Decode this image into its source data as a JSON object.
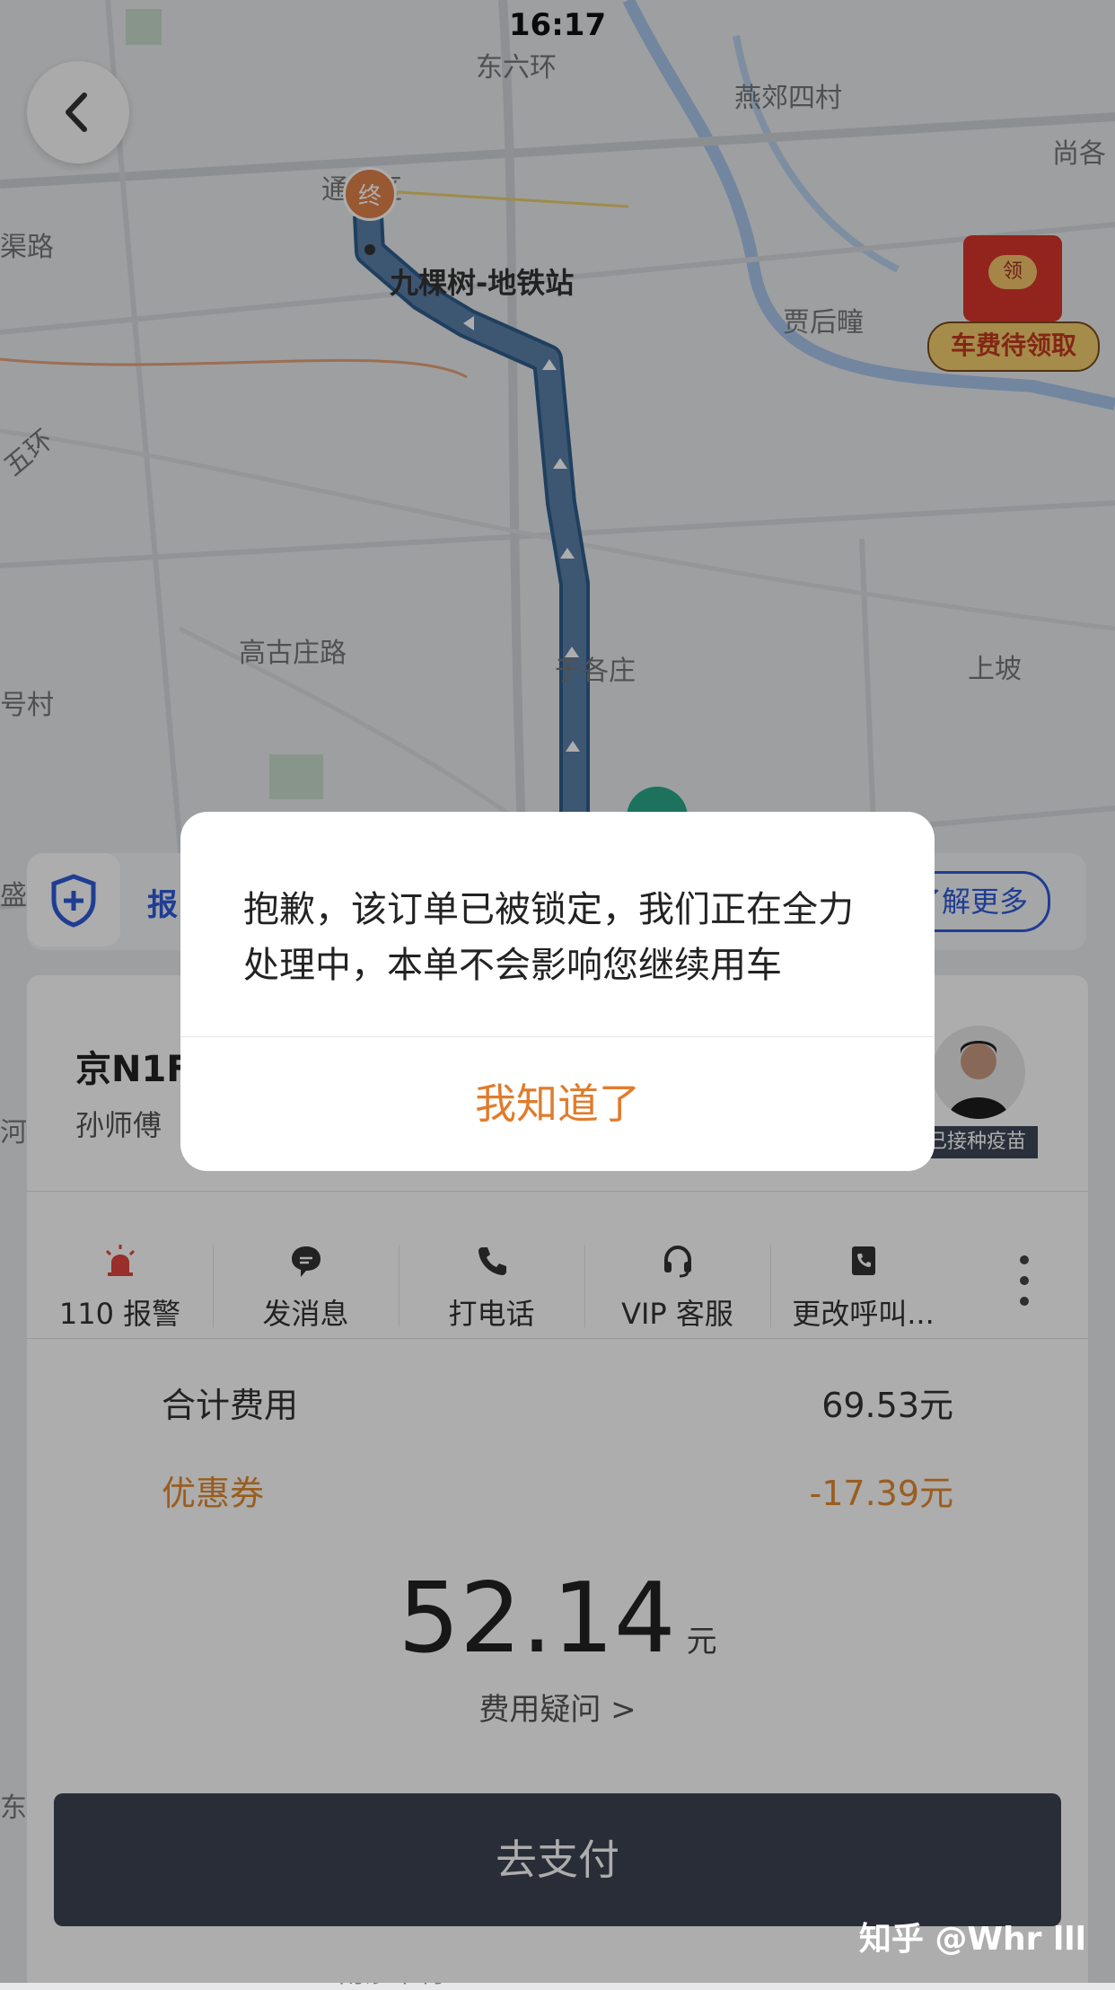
{
  "status_bar": {
    "time": "16:17"
  },
  "map": {
    "labels": {
      "ring_road": "东六环",
      "area1": "燕郊四村",
      "area2": "尚各",
      "area3": "渠路",
      "area4": "通州区",
      "station": "九棵树-地铁站",
      "area5": "贾后疃",
      "ring5": "五环",
      "area6": "高古庄路",
      "area7": "于各庄",
      "area8": "上坡",
      "area9": "号村",
      "area10": "盛",
      "area11": "南莎平村",
      "area12": "河",
      "area13": "东"
    },
    "end_pin": "终",
    "start_pin": "起"
  },
  "promo": {
    "coin": "领",
    "label": "车费待领取"
  },
  "safety_bar": {
    "text": "报",
    "learn_more": "了解更多"
  },
  "driver": {
    "plate": "京N1F",
    "name": "孙师傅",
    "vaccine_tag": "已接种疫苗"
  },
  "actions": [
    {
      "icon": "alarm-icon",
      "label": "110 报警"
    },
    {
      "icon": "message-icon",
      "label": "发消息"
    },
    {
      "icon": "phone-icon",
      "label": "打电话"
    },
    {
      "icon": "headset-icon",
      "label": "VIP 客服"
    },
    {
      "icon": "contact-book-icon",
      "label": "更改呼叫..."
    }
  ],
  "fees": {
    "total_label": "合计费用",
    "total_value": "69.53元",
    "coupon_label": "优惠券",
    "coupon_value": "-17.39元",
    "final_amount": "52.14",
    "final_unit": "元",
    "question_link": "费用疑问 >"
  },
  "pay_button": "去支付",
  "dialog": {
    "message": "抱歉，该订单已被锁定，我们正在全力处理中，本单不会影响您继续用车",
    "confirm": "我知道了"
  },
  "watermark": "知乎 @Whr lll",
  "colors": {
    "accent_orange": "#e07c2c",
    "route_blue": "#5a7fa8",
    "safety_blue": "#2f5bd8",
    "pay_button": "#3d4351"
  }
}
